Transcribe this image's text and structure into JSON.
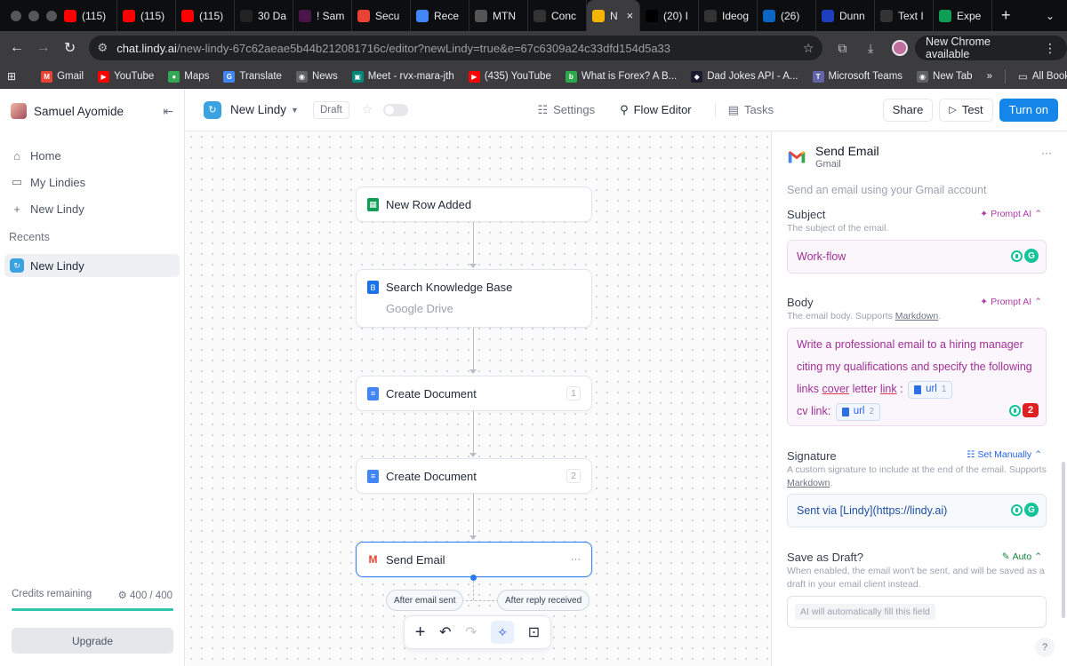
{
  "browser": {
    "tabs": [
      {
        "label": "(115)",
        "icon": "youtube-icon",
        "color": "#ff0000"
      },
      {
        "label": "(115)",
        "icon": "youtube-icon",
        "color": "#ff0000"
      },
      {
        "label": "(115)",
        "icon": "youtube-icon",
        "color": "#ff0000"
      },
      {
        "label": "30 Da",
        "icon": "amazon-icon",
        "color": "#222222"
      },
      {
        "label": "! Sam",
        "icon": "slack-icon",
        "color": "#4a154b"
      },
      {
        "label": "Secu",
        "icon": "gmail-icon",
        "color": "#ea4335"
      },
      {
        "label": "Rece",
        "icon": "google-icon",
        "color": "#4285f4"
      },
      {
        "label": "MTN",
        "icon": "mtn-icon",
        "color": "#555555"
      },
      {
        "label": "Conc",
        "icon": "generic-icon",
        "color": "#333333"
      },
      {
        "label": "N",
        "icon": "lindy-icon",
        "color": "#f5b400",
        "active": true
      },
      {
        "label": "(20) I",
        "icon": "x-icon",
        "color": "#000000"
      },
      {
        "label": "Ideog",
        "icon": "ideogram-icon",
        "color": "#333333"
      },
      {
        "label": "(26)",
        "icon": "linkedin-icon",
        "color": "#0a66c2"
      },
      {
        "label": "Dunn",
        "icon": "dunn-icon",
        "color": "#1d3fbf"
      },
      {
        "label": "Text I",
        "icon": "openai-icon",
        "color": "#333333"
      },
      {
        "label": "Expe",
        "icon": "sheets-icon",
        "color": "#0f9d58"
      }
    ],
    "new_tab": "+",
    "url_host": "chat.lindy.ai",
    "url_path": "/new-lindy-67c62aeae5b44b212081716c/editor?newLindy=true&e=67c6309a24c33dfd154d5a33",
    "new_chrome": "New Chrome available",
    "bookmarks": [
      {
        "label": "Gmail",
        "color": "#ea4335",
        "glyph": "M"
      },
      {
        "label": "YouTube",
        "color": "#ff0000",
        "glyph": "▶"
      },
      {
        "label": "Maps",
        "color": "#34a853",
        "glyph": "●"
      },
      {
        "label": "Translate",
        "color": "#4285f4",
        "glyph": "G"
      },
      {
        "label": "News",
        "color": "#5f6368",
        "glyph": "◉"
      },
      {
        "label": "Meet - rvx-mara-jth",
        "color": "#00897b",
        "glyph": "▣"
      },
      {
        "label": "(435) YouTube",
        "color": "#ff0000",
        "glyph": "▶"
      },
      {
        "label": "What is Forex? A B...",
        "color": "#2ea84f",
        "glyph": "b"
      },
      {
        "label": "Dad Jokes API - A...",
        "color": "#1a1a2e",
        "glyph": "◆"
      },
      {
        "label": "Microsoft Teams",
        "color": "#6264a7",
        "glyph": "T"
      },
      {
        "label": "New Tab",
        "color": "#5f6368",
        "glyph": "◉"
      }
    ],
    "bookmarks_more": "»",
    "all_bookmarks": "All Bookmarks"
  },
  "sidebar": {
    "user_name": "Samuel Ayomide",
    "nav": [
      {
        "label": "Home",
        "icon": "home-icon"
      },
      {
        "label": "My Lindies",
        "icon": "folder-icon"
      },
      {
        "label": "New Lindy",
        "icon": "plus-icon"
      }
    ],
    "recents_title": "Recents",
    "recents": [
      {
        "label": "New Lindy"
      }
    ],
    "credits_label": "Credits remaining",
    "credits_value": "400 / 400",
    "credits_fraction": 1.0,
    "upgrade_label": "Upgrade"
  },
  "topbar": {
    "name": "New Lindy",
    "status": "Draft",
    "tabs": [
      {
        "label": "Settings",
        "icon": "settings-icon"
      },
      {
        "label": "Flow Editor",
        "icon": "flow-icon",
        "active": true
      },
      {
        "label": "Tasks",
        "icon": "tasks-icon"
      }
    ],
    "share_label": "Share",
    "test_label": "Test",
    "turn_on_label": "Turn on"
  },
  "canvas": {
    "nodes": [
      {
        "label": "New Row Added",
        "icon": "sheets-icon",
        "color": "#0f9d58"
      },
      {
        "label": "Search Knowledge Base",
        "sub": "Google Drive",
        "icon": "knowledge-base-icon",
        "color": "#1a73e8"
      },
      {
        "label": "Create Document",
        "badge": "1",
        "icon": "docs-icon",
        "color": "#4285f4"
      },
      {
        "label": "Create Document",
        "badge": "2",
        "icon": "docs-icon",
        "color": "#4285f4"
      },
      {
        "label": "Send Email",
        "icon": "gmail-icon",
        "color": "#ea4335",
        "selected": true,
        "more": "···"
      }
    ],
    "branches": [
      "After email sent",
      "After reply received"
    ]
  },
  "panel": {
    "title": "Send Email",
    "subtitle": "Gmail",
    "more": "···",
    "description": "Send an email using your Gmail account",
    "fields": {
      "subject": {
        "label": "Subject",
        "help": "The subject of the email.",
        "mode": "Prompt AI",
        "value": "Work-flow"
      },
      "body": {
        "label": "Body",
        "help": "The email body. Supports Markdown.",
        "help_link": "Markdown",
        "mode": "Prompt AI",
        "text_1": "Write a professional email to a hiring manager citing my qualifications and specify the following links",
        "text_cover": "cover",
        "text_letter": "letter",
        "text_link": "link",
        "text_colon": ":",
        "chip_1": "url",
        "chip_1_num": "1",
        "text_cv": "cv link:",
        "chip_2": "url",
        "chip_2_num": "2",
        "grammarly_count": "2"
      },
      "signature": {
        "label": "Signature",
        "help_1": "A custom signature to include at the end of the email. Supports",
        "help_link": "Markdown",
        "mode": "Set Manually",
        "value": "Sent via [Lindy](https://lindy.ai)"
      },
      "draft": {
        "label": "Save as Draft?",
        "help": "When enabled, the email won't be sent, and will be saved as a draft in your email client instead.",
        "mode": "Auto",
        "placeholder": "AI will automatically fill this field"
      }
    },
    "help": "?"
  }
}
